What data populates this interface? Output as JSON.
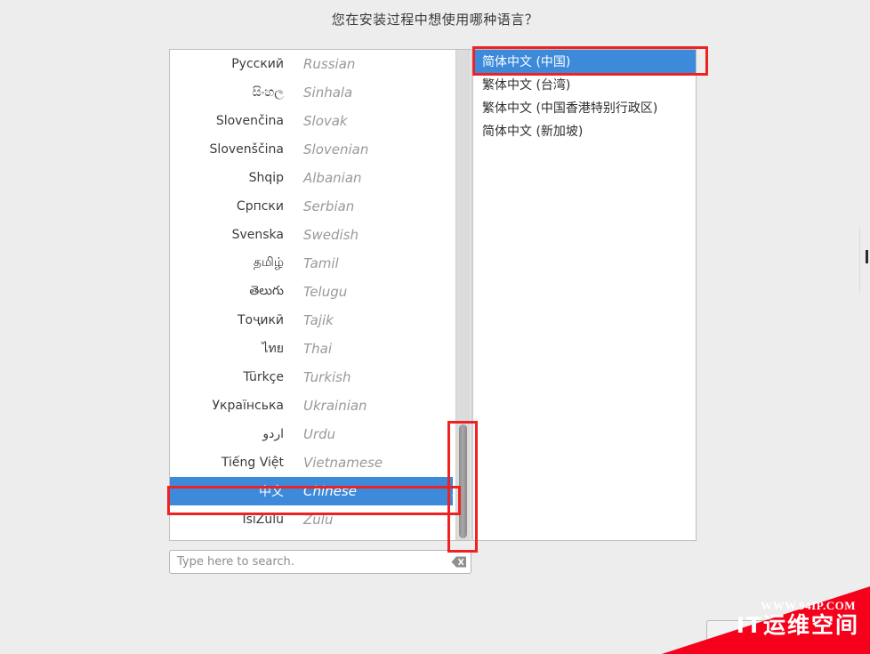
{
  "heading": "您在安装过程中想使用哪种语言？",
  "language_list": {
    "items": [
      {
        "native": "Русский",
        "english": "Russian",
        "selected": false
      },
      {
        "native": "සිංහල",
        "english": "Sinhala",
        "selected": false
      },
      {
        "native": "Slovenčina",
        "english": "Slovak",
        "selected": false
      },
      {
        "native": "Slovenščina",
        "english": "Slovenian",
        "selected": false
      },
      {
        "native": "Shqip",
        "english": "Albanian",
        "selected": false
      },
      {
        "native": "Српски",
        "english": "Serbian",
        "selected": false
      },
      {
        "native": "Svenska",
        "english": "Swedish",
        "selected": false
      },
      {
        "native": "தமிழ்",
        "english": "Tamil",
        "selected": false
      },
      {
        "native": "తెలుగు",
        "english": "Telugu",
        "selected": false
      },
      {
        "native": "Тоҷикӣ",
        "english": "Tajik",
        "selected": false
      },
      {
        "native": "ไทย",
        "english": "Thai",
        "selected": false
      },
      {
        "native": "Türkçe",
        "english": "Turkish",
        "selected": false
      },
      {
        "native": "Українська",
        "english": "Ukrainian",
        "selected": false
      },
      {
        "native": "اردو",
        "english": "Urdu",
        "selected": false
      },
      {
        "native": "Tiếng Việt",
        "english": "Vietnamese",
        "selected": false
      },
      {
        "native": "中文",
        "english": "Chinese",
        "selected": true,
        "submenu_icon": "chevron-right-icon"
      },
      {
        "native": "IsiZulu",
        "english": "Zulu",
        "selected": false
      }
    ]
  },
  "variant_list": {
    "items": [
      {
        "label": "简体中文 (中国)",
        "selected": true
      },
      {
        "label": "繁体中文 (台湾)",
        "selected": false
      },
      {
        "label": "繁体中文 (中国香港特别行政区)",
        "selected": false
      },
      {
        "label": "简体中文 (新加坡)",
        "selected": false
      }
    ]
  },
  "search": {
    "value": "",
    "placeholder": "Type here to search.",
    "clear_icon": "backspace-clear-icon"
  },
  "scrollbar": {
    "orientation": "vertical",
    "thumb_position": "near-bottom"
  },
  "annotations": [
    {
      "name": "annotation-variant-selected",
      "color": "#ee2222"
    },
    {
      "name": "annotation-chinese-row",
      "color": "#ee2222"
    },
    {
      "name": "annotation-scrollbar",
      "color": "#ee2222"
    }
  ],
  "watermark": {
    "url": "WWW.94IP.COM",
    "name": "IT运维空间",
    "color": "#f6001b"
  },
  "colors": {
    "selection_blue": "#3c8ad9",
    "background": "#ededed",
    "panel": "#ffffff",
    "english_text": "#999999"
  }
}
